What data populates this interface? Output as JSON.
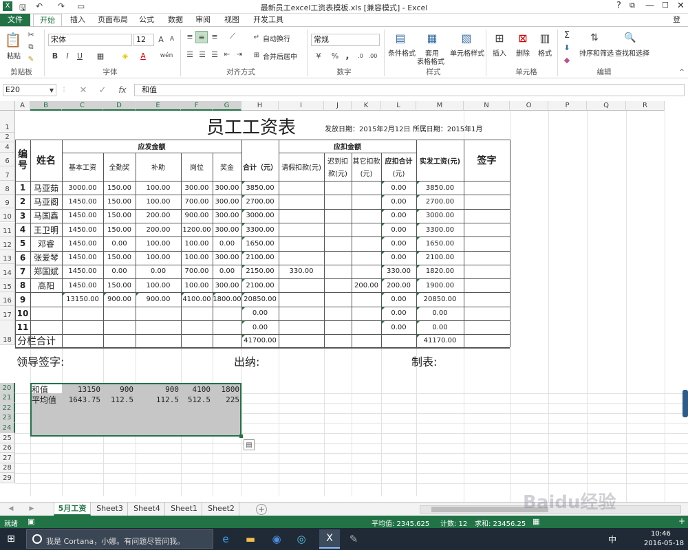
{
  "window": {
    "title": "最新员工excel工资表模板.xls  [兼容模式] - Excel",
    "login": "登录",
    "help": "?",
    "restore_icon": "ribbon-display-icon",
    "min": "—",
    "max": "☐",
    "close": "✕"
  },
  "ribbon_tabs": [
    "文件",
    "开始",
    "插入",
    "页面布局",
    "公式",
    "数据",
    "审阅",
    "视图",
    "开发工具"
  ],
  "ribbon": {
    "paste": "粘贴",
    "clipboard": "剪贴板",
    "font_name": "宋体",
    "font_size": "12",
    "font_grp": "字体",
    "bold": "B",
    "italic": "I",
    "underline": "U",
    "wrap": "自动换行",
    "merge": "合并后居中",
    "align_grp": "对齐方式",
    "num_format": "常规",
    "num_grp": "数字",
    "pct": "%",
    "comma": ",",
    "cond_fmt": "条件格式",
    "table_fmt1": "套用",
    "table_fmt2": "表格格式",
    "cell_style": "单元格样式",
    "style_grp": "样式",
    "insert": "插入",
    "delete": "删除",
    "format": "格式",
    "cells_grp": "单元格",
    "sort": "排序和筛选",
    "find": "查找和选择",
    "edit_grp": "编辑"
  },
  "formula_bar": {
    "name_box": "E20",
    "fx": "fx",
    "value": "和值"
  },
  "columns": [
    "A",
    "B",
    "C",
    "D",
    "E",
    "F",
    "G",
    "H",
    "I",
    "J",
    "K",
    "L",
    "M",
    "N",
    "O",
    "P",
    "Q",
    "R"
  ],
  "rows": [
    "1",
    "2",
    "4",
    "6",
    "7",
    "8",
    "9",
    "10",
    "11",
    "12",
    "13",
    "14",
    "15",
    "16",
    "17",
    "18",
    "20",
    "21",
    "22",
    "23",
    "24",
    "25",
    "26",
    "27",
    "28",
    "29"
  ],
  "sheet": {
    "title": "员工工资表",
    "meta": "发放日期：2015年2月12日 所属日期：2015年1月",
    "h_no": "编号",
    "h_name": "姓名",
    "h_pay_group": "应发金额",
    "h_ded_group": "应扣金额",
    "h_base": "基本工资",
    "h_attend": "全勤奖",
    "h_subsidy": "补助",
    "h_post": "岗位",
    "h_bonus": "奖金",
    "h_total": "合计（元）",
    "h_leave": "请假扣款(元)",
    "h_late1": "迟到扣",
    "h_late2": "款(元)",
    "h_other1": "其它扣款",
    "h_other2": "(元)",
    "h_dedtotal1": "应扣合计",
    "h_dedtotal2": "(元)",
    "h_net": "实发工资(元)",
    "h_sign": "签字",
    "rows": [
      {
        "no": "1",
        "name": "马亚茹",
        "base": "3000.00",
        "attend": "150.00",
        "subsidy": "100.00",
        "post": "300.00",
        "bonus": "300.00",
        "total": "3850.00",
        "leave": "",
        "late": "",
        "other": "",
        "ded": "0.00",
        "net": "3850.00"
      },
      {
        "no": "2",
        "name": "马亚阁",
        "base": "1450.00",
        "attend": "150.00",
        "subsidy": "100.00",
        "post": "700.00",
        "bonus": "300.00",
        "total": "2700.00",
        "leave": "",
        "late": "",
        "other": "",
        "ded": "0.00",
        "net": "2700.00"
      },
      {
        "no": "3",
        "name": "马国鑫",
        "base": "1450.00",
        "attend": "150.00",
        "subsidy": "200.00",
        "post": "900.00",
        "bonus": "300.00",
        "total": "3000.00",
        "leave": "",
        "late": "",
        "other": "",
        "ded": "0.00",
        "net": "3000.00"
      },
      {
        "no": "4",
        "name": "王卫明",
        "base": "1450.00",
        "attend": "150.00",
        "subsidy": "200.00",
        "post": "1200.00",
        "bonus": "300.00",
        "total": "3300.00",
        "leave": "",
        "late": "",
        "other": "",
        "ded": "0.00",
        "net": "3300.00"
      },
      {
        "no": "5",
        "name": "邓睿",
        "base": "1450.00",
        "attend": "0.00",
        "subsidy": "100.00",
        "post": "100.00",
        "bonus": "0.00",
        "total": "1650.00",
        "leave": "",
        "late": "",
        "other": "",
        "ded": "0.00",
        "net": "1650.00"
      },
      {
        "no": "6",
        "name": "张爱琴",
        "base": "1450.00",
        "attend": "150.00",
        "subsidy": "100.00",
        "post": "100.00",
        "bonus": "300.00",
        "total": "2100.00",
        "leave": "",
        "late": "",
        "other": "",
        "ded": "0.00",
        "net": "2100.00"
      },
      {
        "no": "7",
        "name": "郑国斌",
        "base": "1450.00",
        "attend": "0.00",
        "subsidy": "0.00",
        "post": "700.00",
        "bonus": "0.00",
        "total": "2150.00",
        "leave": "330.00",
        "late": "",
        "other": "",
        "ded": "330.00",
        "net": "1820.00"
      },
      {
        "no": "8",
        "name": "高阳",
        "base": "1450.00",
        "attend": "150.00",
        "subsidy": "100.00",
        "post": "100.00",
        "bonus": "300.00",
        "total": "2100.00",
        "leave": "",
        "late": "",
        "other": "200.00",
        "ded": "200.00",
        "net": "1900.00"
      },
      {
        "no": "9",
        "name": "",
        "base": "13150.00",
        "attend": "900.00",
        "subsidy": "900.00",
        "post": "4100.00",
        "bonus": "1800.00",
        "total": "20850.00",
        "leave": "",
        "late": "",
        "other": "",
        "ded": "0.00",
        "net": "20850.00"
      },
      {
        "no": "10",
        "name": "",
        "base": "",
        "attend": "",
        "subsidy": "",
        "post": "",
        "bonus": "",
        "total": "0.00",
        "leave": "",
        "late": "",
        "other": "",
        "ded": "0.00",
        "net": "0.00"
      },
      {
        "no": "11",
        "name": "",
        "base": "",
        "attend": "",
        "subsidy": "",
        "post": "",
        "bonus": "",
        "total": "0.00",
        "leave": "",
        "late": "",
        "other": "",
        "ded": "0.00",
        "net": "0.00"
      }
    ],
    "subtotal_label": "分栏合计",
    "subtotal_total": "41700.00",
    "subtotal_net": "41170.00",
    "sign_leader": "领导签字:",
    "sign_cashier": "出纳:",
    "sign_maker": "制表:",
    "stats": [
      {
        "label": "和值",
        "v1": "13150",
        "v2": "900",
        "v3": "900",
        "v4": "4100",
        "v5": "1800"
      },
      {
        "label": "平均值",
        "v1": "1643.75",
        "v2": "112.5",
        "v3": "112.5",
        "v4": "512.5",
        "v5": "225"
      }
    ]
  },
  "sheet_tabs": [
    "5月工资",
    "Sheet3",
    "Sheet4",
    "Sheet1",
    "Sheet2"
  ],
  "status": {
    "ready": "就绪",
    "avg": "平均值: 2345.625",
    "count": "计数: 12",
    "sum": "求和: 23456.25",
    "zoom": "+"
  },
  "taskbar": {
    "search": "我是 Cortana，小娜。有问题尽管问我。",
    "time": "10:46",
    "date": "2016-05-18",
    "ime": "中"
  },
  "watermark": "Baidu经验 jingyan.baidu.com"
}
